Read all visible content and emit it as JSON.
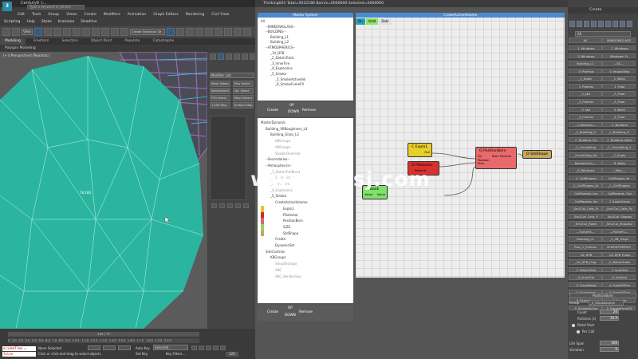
{
  "max": {
    "title": "Century6_t...",
    "menu1": [
      "Edit",
      "Tools",
      "Group",
      "Views",
      "Create",
      "Modifiers",
      "Animation",
      "Graph Editors",
      "Rendering",
      "Civil View"
    ],
    "menu2": [
      "Scripting",
      "Help",
      "Stoke",
      "Krakatoa",
      "Deadline"
    ],
    "search_placeholder": "Type a keyword or phrase",
    "view_select": "View",
    "create_select": "Create Selection Se",
    "ribbon_tabs": [
      "Modeling",
      "Freeform",
      "Selection",
      "Object Paint",
      "Populate",
      "Catastrophe"
    ],
    "ribbon_sub": "Polygon Modeling",
    "viewport_label": "[+] [Perspective] [Realistic]",
    "poly_count": "78,180",
    "modifier_list": "Modifier List",
    "cmd_buttons": [
      "Mesh Select",
      "Poly Select",
      "SplineSelect",
      "Vol. Select",
      "FFD Select",
      "Patch Select",
      "1,000 Map",
      "Surface Map"
    ],
    "frame_readout": "125 / 77",
    "ruler": "0  10  20  30  40  50  60  70  80  90  100  110  120  130  140  150  160  170  180  190  200",
    "script_line1": "elidedTime =",
    "script_line2": "false",
    "status1": "None Selected",
    "status2": "Click or click-and-drag to select objects",
    "auto_key": "Auto Key",
    "set_key": "Set Key",
    "selected": "Selected",
    "key_filters": "Key Filters...",
    "frame": "125"
  },
  "thinking": {
    "title": "Thinking001  Total=0022186  Born/s=0000000  Selected=0000000",
    "master_head": "Master System",
    "master_tree": [
      "All",
      "--WINDOWGLASS--",
      "--BUILDING--",
      "Building_L1",
      "Building_L2",
      "--ATMOSPHERICS--",
      "_1A_DFB",
      "_2_DebrisTrails",
      "_3_InnerFire",
      "_4_Explosions",
      "_5_Smoke",
      "_5_SmokeActiveVol",
      "_6_SmokeFumeFX"
    ],
    "btn_create": "Create",
    "btn_up": "UP",
    "btn_down": "DOWN",
    "btn_remove": "Remove",
    "dyn_tree": [
      "MasterDynamic",
      "Building_VBRoughness_L4",
      "Building_Glass_L3",
      "KBGroups",
      "VBGroups",
      "ShaderOverride",
      "--Secondaries--",
      "--Atmospherics--",
      "_1_DebrisFireBurst",
      "_2_DebrisTrails",
      "_3_InnerFire",
      "_4_Explosions",
      "_5_Smoke",
      "CreateActiveVolume",
      "Explo1",
      "PSelector",
      "PositionBorn",
      "SIZE",
      "StdShape",
      "Create",
      "DynamicSet",
      "SimControls",
      "KBGroups",
      "Smoothshape",
      "ABC",
      "ABC_RenderGeo"
    ],
    "graph_head": "CreateActiveVolume",
    "graph_tabs": [
      "On",
      "Valid",
      "Debi"
    ],
    "nodes": {
      "explo": {
        "title": "C Explo1",
        "port": "Out"
      },
      "psel": {
        "title": "O PSelector",
        "port": "Particle"
      },
      "pborn": {
        "title": "O PositionBorn",
        "ports": [
          "On",
          "Position",
          "Size"
        ],
        "extra": "Born Particle"
      },
      "std": {
        "title": "O StdShape"
      },
      "hbox": {
        "title": "H BoxE",
        "port1": "Value",
        "port2": "Value"
      }
    }
  },
  "create": {
    "title": "Create",
    "filter": "All",
    "list": [
      [
        "All",
        "WINDOWGLASS"
      ],
      [
        "_1_Windows",
        "_2_Windows"
      ],
      [
        "_3_Windows",
        "Windows_Fr"
      ],
      [
        "Building_L1",
        "---SC---"
      ],
      [
        "_0_PreFrag",
        "_0_ImpactTest"
      ],
      [
        "_1_Static",
        "_1_Wall1"
      ],
      [
        "_1_Frames",
        "_1_Floor"
      ],
      [
        "_2_sb1",
        "_2_Floor"
      ],
      [
        "_2_Frames",
        "_3_Floor"
      ],
      [
        "_3_sb2",
        "_3_Wall1"
      ],
      [
        "_3_Frames",
        "_4_Floor"
      ],
      [
        "---Collisions---",
        "_C_Building"
      ],
      [
        "_C_Building_Fl",
        "_C_Building_Fr"
      ],
      [
        "_C_Building_Flo",
        "_C_Building_Wind"
      ],
      [
        "_C_Unyielding",
        "_C_Unyielding_2"
      ],
      [
        "_Unyielding_Ub",
        "_C_Explo"
      ],
      [
        "RenderOnly---",
        "_R_Walls"
      ],
      [
        "_R_Windows",
        "---Misc---"
      ],
      [
        "_C_CellShapes",
        "CellShapes_br"
      ],
      [
        "_C_CellShapes_Gr",
        "_C_CellShapes"
      ],
      [
        "_CellParents_brn",
        "_CellParents_Out"
      ],
      [
        "_CellParents_lev",
        "_1_ExploOrigin"
      ],
      [
        "_Sm2Cal_Cells_Fr",
        "_Sm2Cal_Cells_Po"
      ],
      [
        "_Sm2Cal_Cells_P",
        "_Sm2Cal_Shapes"
      ],
      [
        "_Sm2Cal_Rotat",
        "_Sm2Cal_Shapes2"
      ],
      [
        "---FumeFX---",
        "---PumeFx---"
      ],
      [
        "Building_L2",
        "_2_VB_Frags"
      ],
      [
        "Pool_1_Frames",
        "ATMOSPHERICS"
      ],
      [
        "_1A_DFB",
        "_1A_DFB_Frags"
      ],
      [
        "_1A_DFB_Frag",
        "_2_DebrisTrails"
      ],
      [
        "_2_DebrisTrail",
        "_3_InnerFire"
      ],
      [
        "_3_InnerFire",
        "_3_Volume"
      ],
      [
        "_3_OriginPaint",
        "_4_FumeFXFire"
      ],
      [
        "_4_Explosions",
        "_4_FumeFXExp"
      ],
      [
        "_5_Explosions",
        "_5_Smoke"
      ],
      [
        "_5_SmokeActive",
        "_5_SmokeFumeFX"
      ]
    ],
    "pb_title": "PositionBorn",
    "group_label": "Group",
    "group_value": "_5_SmokeActive",
    "count_label": "Count",
    "count_value": "20",
    "particles_label": "Particles [s]",
    "particles_value": "25.0",
    "pshot_label": "Pistol Shot",
    "percall_label": "Per Call",
    "lifespan_label": "Life Span",
    "lifespan_value": "100",
    "variation_label": "Variation",
    "variation_value": "0"
  },
  "watermark": "www.cgtsj.com"
}
